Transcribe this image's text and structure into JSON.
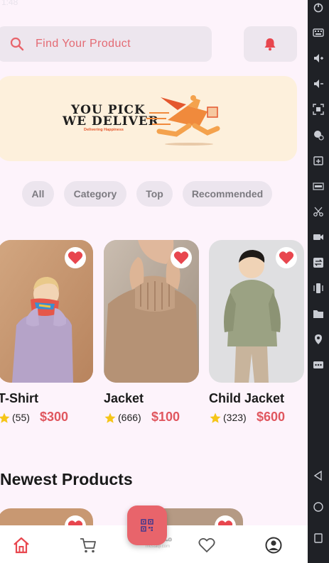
{
  "status_bar": {
    "time": "1:48"
  },
  "search": {
    "placeholder": "Find Your Product"
  },
  "banner": {
    "title_line1": "YOU PICK",
    "title_line2": "WE DELIVER",
    "subtitle": "Delivering Happiness"
  },
  "filters": [
    "All",
    "Category",
    "Top",
    "Recommended"
  ],
  "products": [
    {
      "name": "T-Shirt",
      "reviews": "(55)",
      "price": "$300"
    },
    {
      "name": "Jacket",
      "reviews": "(666)",
      "price": "$100"
    },
    {
      "name": "Child Jacket",
      "reviews": "(323)",
      "price": "$600"
    }
  ],
  "sections": {
    "newest": "Newest Products"
  },
  "watermark": {
    "text": "مستقل",
    "sub": "mostaql.com"
  },
  "icons": {
    "search": "search-icon",
    "bell": "bell-icon",
    "heart": "heart-icon",
    "star": "star-icon",
    "home": "home-icon",
    "cart": "cart-icon",
    "qr": "qr-code-icon",
    "favorites": "heart-outline-icon",
    "profile": "profile-icon"
  },
  "colors": {
    "accent": "#e8646b",
    "background": "#fdf3fb",
    "chip": "#ece5ee",
    "star": "#f5c518",
    "price": "#e0575f"
  }
}
